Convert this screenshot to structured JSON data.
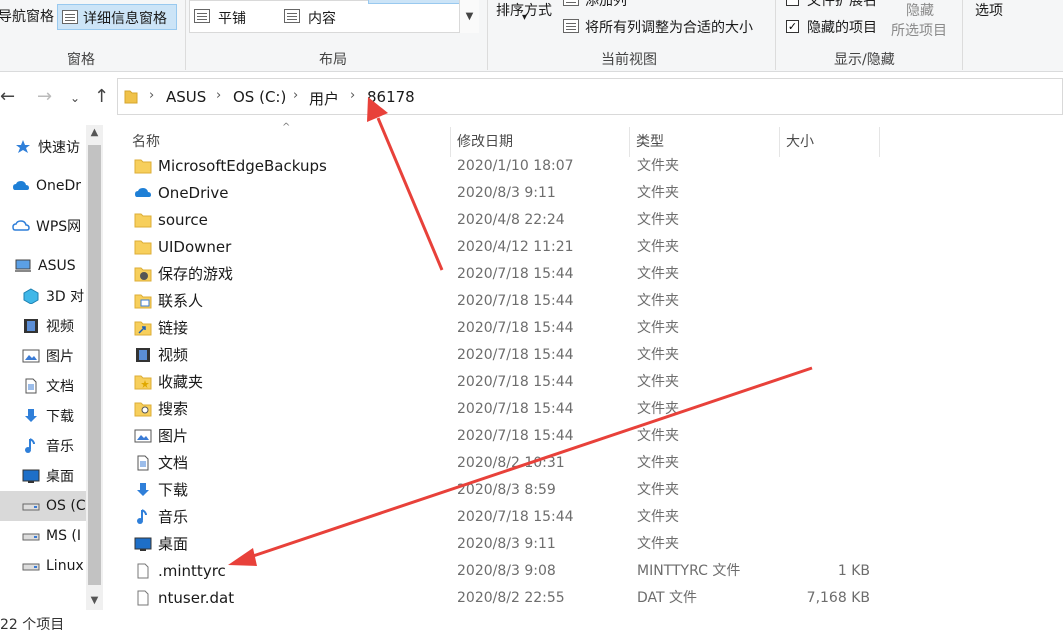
{
  "ribbon": {
    "pane_group": {
      "nav_pane_label": "导航窗格",
      "details_pane_label": "详细信息窗格",
      "group_label": "窗格"
    },
    "layout_group": {
      "tiles_label": "平铺",
      "content_label": "内容",
      "group_label": "布局"
    },
    "current_view_group": {
      "sort_label": "排序方式",
      "add_column_label": "添加列",
      "fit_columns_label": "将所有列调整为合适的大小",
      "group_label": "当前视图"
    },
    "show_hide_group": {
      "file_ext_label": "文件扩展名",
      "hidden_items_label": "隐藏的项目",
      "hidden_items_checked": true,
      "hide_label": "隐藏",
      "hide_selected_label": "所选项目",
      "group_label": "显示/隐藏"
    },
    "options_label": "选项"
  },
  "address": {
    "back_icon": "arrow-left-icon",
    "forward_icon": "arrow-right-icon",
    "recent_icon": "chevron-down-icon",
    "up_icon": "arrow-up-icon",
    "crumbs": [
      "ASUS",
      "OS (C:)",
      "用户",
      "86178"
    ]
  },
  "nav_pane": {
    "items": [
      {
        "label": "快速访",
        "icon": "star-icon"
      },
      {
        "label": "OneDr",
        "icon": "cloud-icon"
      },
      {
        "label": "WPS网",
        "icon": "wps-cloud-icon"
      },
      {
        "label": "ASUS",
        "icon": "computer-icon"
      },
      {
        "label": "3D 对",
        "icon": "cube-icon"
      },
      {
        "label": "视频",
        "icon": "film-icon"
      },
      {
        "label": "图片",
        "icon": "picture-icon"
      },
      {
        "label": "文档",
        "icon": "document-icon"
      },
      {
        "label": "下载",
        "icon": "download-icon"
      },
      {
        "label": "音乐",
        "icon": "music-icon"
      },
      {
        "label": "桌面",
        "icon": "desktop-icon"
      },
      {
        "label": "OS (C",
        "icon": "drive-icon"
      },
      {
        "label": "MS (I",
        "icon": "drive-icon"
      },
      {
        "label": "Linux",
        "icon": "drive-icon"
      }
    ],
    "selected_index": 11
  },
  "columns": {
    "name": "名称",
    "date": "修改日期",
    "type": "类型",
    "size": "大小"
  },
  "files": [
    {
      "name": "MicrosoftEdgeBackups",
      "date": "2020/1/10 18:07",
      "type": "文件夹",
      "size": "",
      "icon": "folder-icon"
    },
    {
      "name": "OneDrive",
      "date": "2020/8/3 9:11",
      "type": "文件夹",
      "size": "",
      "icon": "onedrive-folder-icon"
    },
    {
      "name": "source",
      "date": "2020/4/8 22:24",
      "type": "文件夹",
      "size": "",
      "icon": "folder-icon"
    },
    {
      "name": "UIDowner",
      "date": "2020/4/12 11:21",
      "type": "文件夹",
      "size": "",
      "icon": "folder-icon"
    },
    {
      "name": "保存的游戏",
      "date": "2020/7/18 15:44",
      "type": "文件夹",
      "size": "",
      "icon": "saved-games-icon"
    },
    {
      "name": "联系人",
      "date": "2020/7/18 15:44",
      "type": "文件夹",
      "size": "",
      "icon": "contacts-icon"
    },
    {
      "name": "链接",
      "date": "2020/7/18 15:44",
      "type": "文件夹",
      "size": "",
      "icon": "links-icon"
    },
    {
      "name": "视频",
      "date": "2020/7/18 15:44",
      "type": "文件夹",
      "size": "",
      "icon": "film-icon"
    },
    {
      "name": "收藏夹",
      "date": "2020/7/18 15:44",
      "type": "文件夹",
      "size": "",
      "icon": "favorites-icon"
    },
    {
      "name": "搜索",
      "date": "2020/7/18 15:44",
      "type": "文件夹",
      "size": "",
      "icon": "search-folder-icon"
    },
    {
      "name": "图片",
      "date": "2020/7/18 15:44",
      "type": "文件夹",
      "size": "",
      "icon": "picture-icon"
    },
    {
      "name": "文档",
      "date": "2020/8/2 10:31",
      "type": "文件夹",
      "size": "",
      "icon": "document-icon"
    },
    {
      "name": "下载",
      "date": "2020/8/3 8:59",
      "type": "文件夹",
      "size": "",
      "icon": "download-icon"
    },
    {
      "name": "音乐",
      "date": "2020/7/18 15:44",
      "type": "文件夹",
      "size": "",
      "icon": "music-icon"
    },
    {
      "name": "桌面",
      "date": "2020/8/3 9:11",
      "type": "文件夹",
      "size": "",
      "icon": "desktop-icon"
    },
    {
      "name": ".minttyrc",
      "date": "2020/8/3 9:08",
      "type": "MINTTYRC 文件",
      "size": "1 KB",
      "icon": "file-icon"
    },
    {
      "name": "ntuser.dat",
      "date": "2020/8/2 22:55",
      "type": "DAT 文件",
      "size": "7,168 KB",
      "icon": "file-icon"
    }
  ],
  "status": {
    "item_count": "22 个项目"
  },
  "annotation": {
    "arrow_color": "#e8413a"
  }
}
